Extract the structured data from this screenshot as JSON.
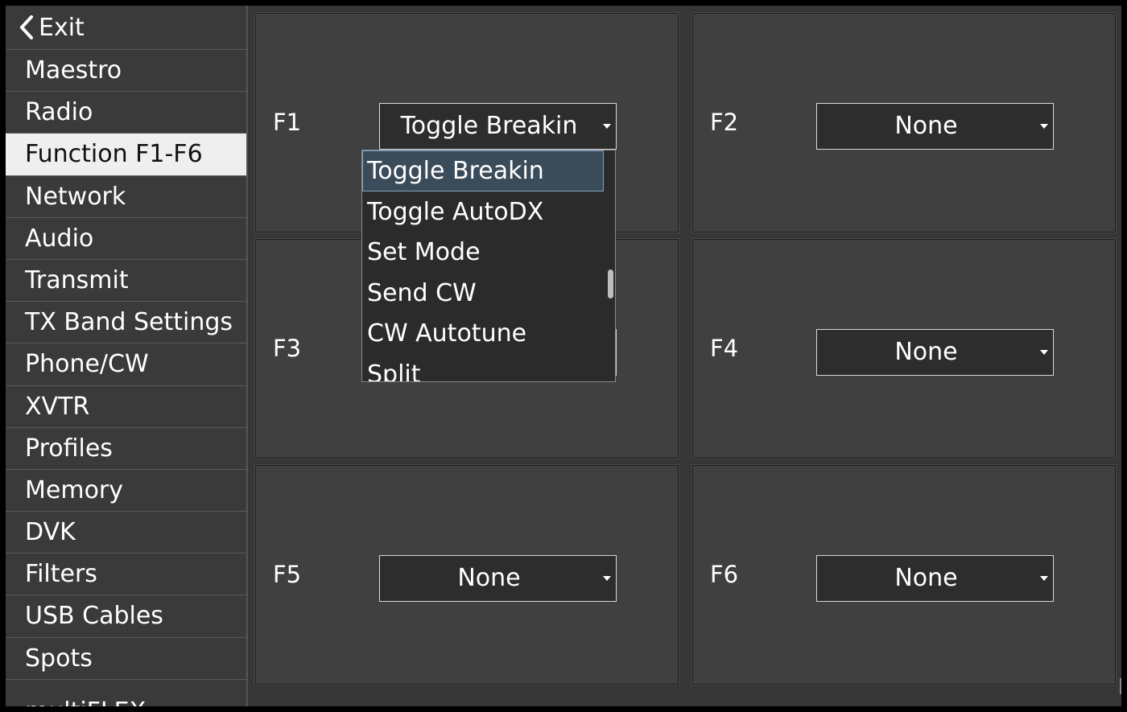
{
  "sidebar": {
    "exit_label": "Exit",
    "items": [
      {
        "label": "Maestro"
      },
      {
        "label": "Radio"
      },
      {
        "label": "Function F1-F6",
        "active": true
      },
      {
        "label": "Network"
      },
      {
        "label": "Audio"
      },
      {
        "label": "Transmit"
      },
      {
        "label": "TX Band Settings"
      },
      {
        "label": "Phone/CW"
      },
      {
        "label": "XVTR"
      },
      {
        "label": "Profiles"
      },
      {
        "label": "Memory"
      },
      {
        "label": "DVK"
      },
      {
        "label": "Filters"
      },
      {
        "label": "USB Cables"
      },
      {
        "label": "Spots"
      },
      {
        "label": "multiFLEX"
      }
    ]
  },
  "functions": {
    "f1": {
      "label": "F1",
      "value": "Toggle Breakin"
    },
    "f2": {
      "label": "F2",
      "value": "None"
    },
    "f3": {
      "label": "F3",
      "value": ""
    },
    "f4": {
      "label": "F4",
      "value": "None"
    },
    "f5": {
      "label": "F5",
      "value": "None"
    },
    "f6": {
      "label": "F6",
      "value": "None"
    }
  },
  "dropdown_open": {
    "options": [
      {
        "label": "Toggle Breakin",
        "selected": true
      },
      {
        "label": "Toggle AutoDX"
      },
      {
        "label": "Set Mode"
      },
      {
        "label": "Send CW"
      },
      {
        "label": "CW Autotune"
      },
      {
        "label": "Split"
      }
    ]
  },
  "colors": {
    "background": "#363636",
    "panel": "#404040",
    "active_nav_bg": "#efefef",
    "selected_option_bg": "#3a4b5a",
    "selected_option_border": "#7fa5c6"
  },
  "icons": {
    "exit": "chevron-left-icon",
    "dropdown": "caret-down-icon"
  }
}
